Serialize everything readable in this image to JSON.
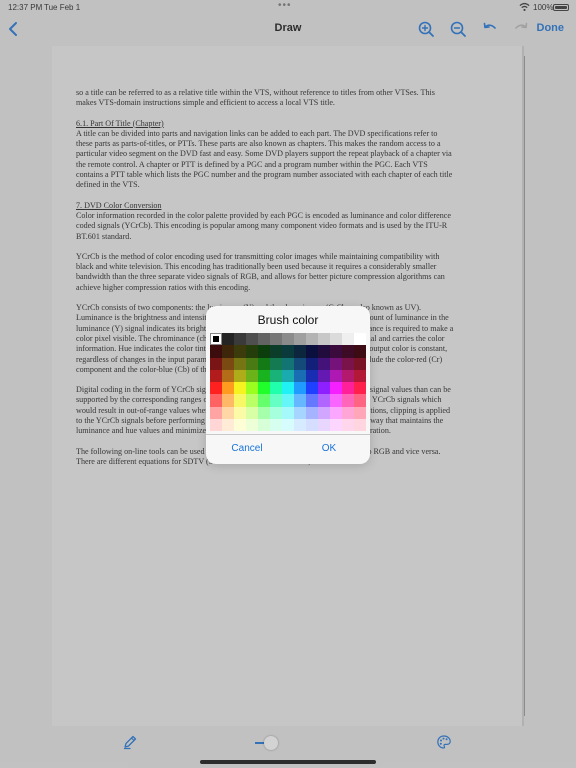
{
  "status_bar": {
    "time": "12:37 PM",
    "date": "Tue Feb 1",
    "battery": "100%"
  },
  "nav": {
    "title": "Draw",
    "done_label": "Done",
    "icons": {
      "back": "chevron-left-icon",
      "zoom_in": "zoom-in-icon",
      "zoom_out": "zoom-out-icon",
      "undo": "undo-icon",
      "redo": "redo-icon"
    }
  },
  "document": {
    "paragraphs": [
      {
        "heading": "",
        "text": "so a title can be referred to as a relative title within the VTS, without reference to titles from other VTSes. This makes VTS-domain instructions simple and efficient to access a local VTS title."
      },
      {
        "heading": "6.1. Part Of Title (Chapter)",
        "text": "A title can be divided into parts and navigation links can be added to each part. The DVD specifications refer to these parts as parts-of-titles, or PTTs. These parts are also known as chapters. This makes the random access to a particular video segment on the DVD fast and easy. Some DVD players support the repeat playback of a chapter via the remote control. A chapter or PTT is defined by a PGC and a program number within the PGC. Each VTS contains a PTT table which lists the PGC number and the program number associated with each chapter of each title defined in the VTS."
      },
      {
        "heading": "7. DVD Color Conversion",
        "text": "Color information recorded in the color palette provided by each PGC is encoded as luminance and color difference coded signals (YCrCb). This encoding is popular among many component video formats and is used by the ITU-R BT.601 standard."
      },
      {
        "heading": "",
        "text": "YCrCb is the method of color encoding used for transmitting color images while maintaining compatibility with black and white television. This encoding has traditionally been used because it requires a considerably smaller bandwidth than the three separate video signals of RGB, and allows for better picture compression algorithms can achieve higher compression ratios with this encoding."
      },
      {
        "heading": "",
        "text": "YCrCb consists of two components: the luminance (Y) and the chrominance (CrCb or also known as UV). Luminance is the brightness and intensity of a pixel of a video signal (pixel color). The amount of luminance in the luminance (Y) signal indicates its brightness (the amount of light emitted). Only the luminance is required to make a color pixel visible. The chrominance (chroma) describes the color portion of the video signal and carries the color information. Hue indicates the color tint, while saturation describes the situation when the output color is constant, regardless of changes in the input parameters. The chrominance components of YCrCb include the color-red (Cr) component and the color-blue (Cb) of the color."
      },
      {
        "heading": "",
        "text": "Digital coding in the form of YCrCb signals can represent a substantially greater gamut of signal values than can be supported by the corresponding ranges of RGB signals. Therefore, it is possible to produce YCrCb signals which would result in out-of-range values when converted to RGB. To prevent overflowing conditions, clipping is applied to the YCrCb signals before performing the RGB conversion. Clipping can be applied in a way that maintains the luminance and hue values and minimize the subjective impairment by sacrificing only saturation."
      },
      {
        "heading": "",
        "text": "The following on-line tools can be used to convert between the two color spaces, YCrCb to RGB and vice versa. There are different equations for SDTV (Standard Definition Television, 525-line and"
      }
    ]
  },
  "dialog": {
    "title": "Brush color",
    "cancel_label": "Cancel",
    "ok_label": "OK",
    "selected_index": 0,
    "palette": [
      [
        "#000000",
        "#242424",
        "#3a3a3a",
        "#4f4f4f",
        "#636363",
        "#777777",
        "#8b8b8b",
        "#9f9f9f",
        "#b3b3b3",
        "#c7c7c7",
        "#dbdbdb",
        "#efefef",
        "#ffffff"
      ],
      [
        "#3d0c0c",
        "#3d260a",
        "#3b3b0b",
        "#253d0b",
        "#0c3d0d",
        "#0b3d2a",
        "#0b3a3d",
        "#0b263d",
        "#0b0f3d",
        "#220b3d",
        "#3b0b3d",
        "#3d0b25",
        "#3d0b14"
      ],
      [
        "#7a1515",
        "#7a4a12",
        "#767513",
        "#497a13",
        "#137a16",
        "#137a52",
        "#137474",
        "#134a7a",
        "#13207a",
        "#44137a",
        "#76137a",
        "#7a134a",
        "#7a1325"
      ],
      [
        "#b31c1c",
        "#b36d18",
        "#aeac19",
        "#6cb319",
        "#19b31f",
        "#19b379",
        "#19abad",
        "#196db3",
        "#192db3",
        "#6419b3",
        "#ae19b3",
        "#b3196c",
        "#b31936"
      ],
      [
        "#ff2020",
        "#ff9b1e",
        "#f5f320",
        "#9aff20",
        "#20ff2a",
        "#20ffac",
        "#20f1f5",
        "#209bff",
        "#2040ff",
        "#8e20ff",
        "#f520ff",
        "#ff209a",
        "#ff204c"
      ],
      [
        "#ff6262",
        "#ffb865",
        "#f8f765",
        "#baff65",
        "#65ff6c",
        "#65ffc6",
        "#65f6f8",
        "#65b8ff",
        "#6579ff",
        "#b165ff",
        "#f865ff",
        "#ff65b8",
        "#ff6583"
      ],
      [
        "#ffa3a3",
        "#ffd6a6",
        "#fbfaa6",
        "#d8ffa6",
        "#a6ffaa",
        "#a6ffdd",
        "#a6f9fb",
        "#a6d6ff",
        "#a6b3ff",
        "#d0a6ff",
        "#fba6ff",
        "#ffa6d6",
        "#ffa6b8"
      ],
      [
        "#ffd6d6",
        "#ffebd6",
        "#fdfdd6",
        "#ecffd6",
        "#d6ffd8",
        "#d6ffef",
        "#d6fcfd",
        "#d6ebff",
        "#d6deff",
        "#e8d6ff",
        "#fdd6ff",
        "#ffd6eb",
        "#ffd6df"
      ]
    ]
  },
  "toolbar": {
    "brush_size_fraction": 0.35,
    "icons": {
      "pen": "pen-icon",
      "palette": "palette-icon"
    },
    "accent": "#1a73d9"
  }
}
